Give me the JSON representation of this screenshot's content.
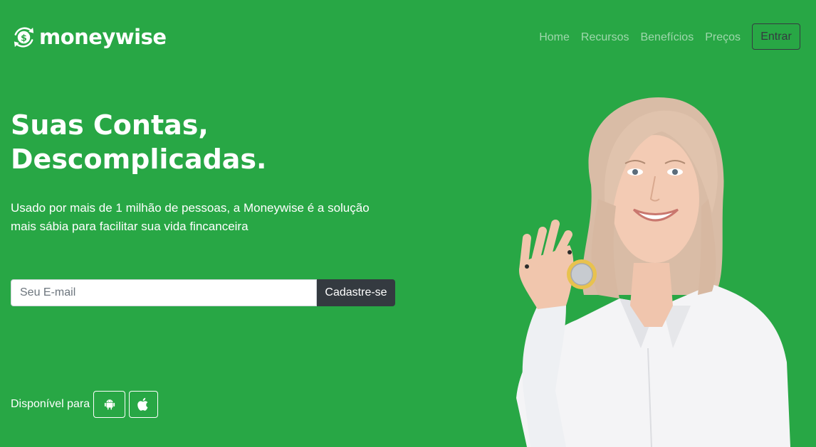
{
  "brand": {
    "name": "moneywise",
    "logo_icon": "dollar-cycle-icon"
  },
  "nav": {
    "links": [
      {
        "label": "Home"
      },
      {
        "label": "Recursos"
      },
      {
        "label": "Benefícios"
      },
      {
        "label": "Preços"
      }
    ],
    "login_label": "Entrar"
  },
  "hero": {
    "title_line1": "Suas Contas,",
    "title_line2": "Descomplicadas.",
    "subtitle": "Usado por mais de 1 milhão de pessoas, a Moneywise é a solução mais sábia para facilitar sua vida fincanceira"
  },
  "signup": {
    "email_placeholder": "Seu E-mail",
    "email_value": "",
    "button_label": "Cadastre-se"
  },
  "available": {
    "label": "Disponível para",
    "platforms": [
      "android-icon",
      "apple-icon"
    ]
  },
  "colors": {
    "background": "#28a745",
    "dark": "#343a40",
    "text": "#ffffff"
  }
}
